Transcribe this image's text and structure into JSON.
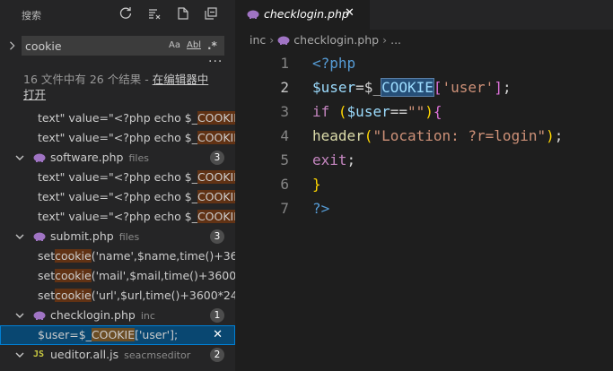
{
  "sidebar": {
    "title": "搜索",
    "search": {
      "value": "cookie",
      "placeholder": "搜索"
    },
    "options": {
      "match_case": "Aa",
      "whole_word": "Abl",
      "regex": ".*"
    },
    "summary": "16 文件中有 26 个结果 - ",
    "open_in_editor": "在编辑器中打开",
    "results": [
      {
        "kind": "match",
        "pre": "text\" value=\"<?php echo $_",
        "hl": "COOKIE",
        "post": "[..."
      },
      {
        "kind": "match",
        "pre": "text\" value=\"<?php echo $_",
        "hl": "COOKIE",
        "post": "[..."
      },
      {
        "kind": "file",
        "icon": "php",
        "name": "software.php",
        "dir": "files",
        "count": "3"
      },
      {
        "kind": "match",
        "pre": "text\" value=\"<?php echo $_",
        "hl": "COOKIE",
        "post": "[..."
      },
      {
        "kind": "match",
        "pre": "text\" value=\"<?php echo $_",
        "hl": "COOKIE",
        "post": "[..."
      },
      {
        "kind": "match",
        "pre": "text\" value=\"<?php echo $_",
        "hl": "COOKIE",
        "post": "[..."
      },
      {
        "kind": "file",
        "icon": "php",
        "name": "submit.php",
        "dir": "files",
        "count": "3"
      },
      {
        "kind": "match",
        "pre": "set",
        "hl": "cookie",
        "post": "('name',$name,time()+360..."
      },
      {
        "kind": "match",
        "pre": "set",
        "hl": "cookie",
        "post": "('mail',$mail,time()+3600*2..."
      },
      {
        "kind": "match",
        "pre": "set",
        "hl": "cookie",
        "post": "('url',$url,time()+3600*24*9..."
      },
      {
        "kind": "file",
        "icon": "php",
        "name": "checklogin.php",
        "dir": "inc",
        "count": "1"
      },
      {
        "kind": "match",
        "pre": "$user=$_",
        "hl": "COOKIE",
        "post": "['user'];",
        "selected": true
      },
      {
        "kind": "file",
        "icon": "js",
        "name": "ueditor.all.js",
        "dir": "seacmseditor",
        "count": "2"
      },
      {
        "kind": "match",
        "pre": "",
        "hl": "",
        "post": ""
      }
    ]
  },
  "editor": {
    "tab_label": "checklogin.php",
    "breadcrumb": {
      "folder": "inc",
      "file": "checklogin.php",
      "more": "..."
    },
    "line_numbers": [
      "1",
      "2",
      "3",
      "4",
      "5",
      "6",
      "7"
    ],
    "lines": [
      [
        {
          "c": "tag",
          "t": "<?php"
        }
      ],
      [
        {
          "c": "var",
          "t": "$user"
        },
        {
          "c": "op",
          "t": "=$_"
        },
        {
          "c": "var match",
          "t": "COOKIE"
        },
        {
          "c": "br2",
          "t": "["
        },
        {
          "c": "str",
          "t": "'user'"
        },
        {
          "c": "br2",
          "t": "]"
        },
        {
          "c": "op",
          "t": ";"
        }
      ],
      [
        {
          "c": "key",
          "t": "if"
        },
        {
          "c": "op",
          "t": " "
        },
        {
          "c": "br",
          "t": "("
        },
        {
          "c": "var",
          "t": "$user"
        },
        {
          "c": "op",
          "t": "=="
        },
        {
          "c": "str",
          "t": "\"\""
        },
        {
          "c": "br",
          "t": ")"
        },
        {
          "c": "br2",
          "t": "{"
        }
      ],
      [
        {
          "c": "fn",
          "t": "header"
        },
        {
          "c": "br",
          "t": "("
        },
        {
          "c": "str",
          "t": "\"Location: ?r=login\""
        },
        {
          "c": "br",
          "t": ")"
        },
        {
          "c": "op",
          "t": ";"
        }
      ],
      [
        {
          "c": "key",
          "t": "exit"
        },
        {
          "c": "op",
          "t": ";"
        }
      ],
      [
        {
          "c": "br",
          "t": "}"
        }
      ],
      [
        {
          "c": "tag",
          "t": "?>"
        }
      ]
    ]
  }
}
